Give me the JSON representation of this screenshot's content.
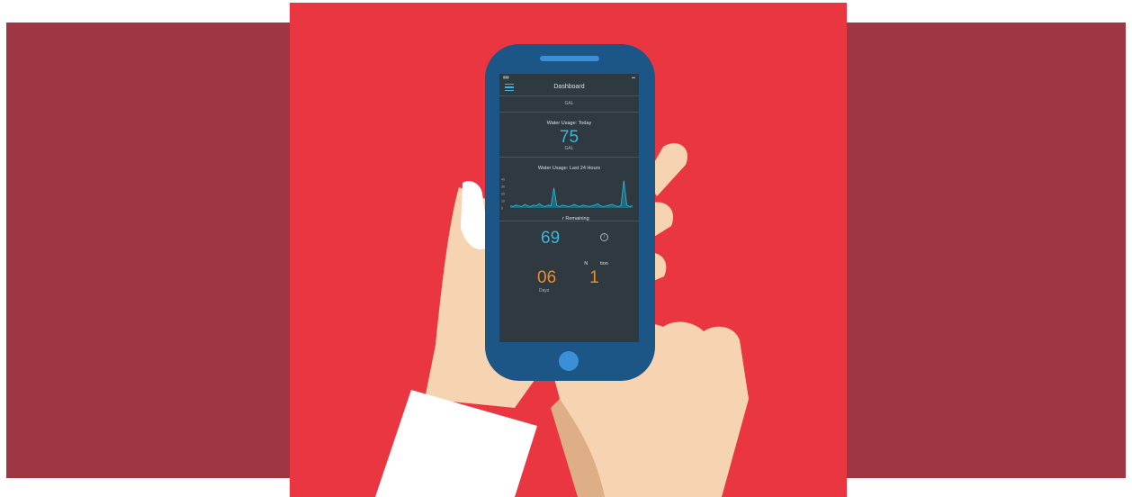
{
  "colors": {
    "background_side": "#9e3644",
    "background_center": "#ea3641",
    "phone_body": "#1b5687",
    "screen": "#2e3940",
    "accent": "#3ab6e0",
    "countdown": "#f08a2a",
    "skin": "#f7d4b1"
  },
  "screen": {
    "nav_title": "Dashboard",
    "top_unit": "GAL",
    "today": {
      "title": "Water Usage: Today",
      "value": "75",
      "unit": "GAL"
    },
    "last24": {
      "title": "Water Usage: Last 24 Hours"
    },
    "filter": {
      "title": "r Remaining",
      "value": "69"
    },
    "next": {
      "title": "N",
      "title_end": "tion",
      "value_start": "06",
      "value_end": "1",
      "label": "Days"
    }
  },
  "chart_data": {
    "type": "line",
    "y_ticks": [
      "40",
      "30",
      "20",
      "10",
      "0"
    ],
    "series": [
      {
        "values": [
          3,
          2,
          4,
          3,
          2,
          5,
          3,
          2,
          4,
          3,
          6,
          3,
          2,
          4,
          3,
          28,
          3,
          2,
          4,
          3,
          2,
          3,
          5,
          3,
          2,
          4,
          3,
          2,
          3,
          4,
          6,
          3,
          2,
          3,
          4,
          5,
          3,
          2,
          3,
          38,
          4,
          2,
          3
        ]
      }
    ]
  }
}
